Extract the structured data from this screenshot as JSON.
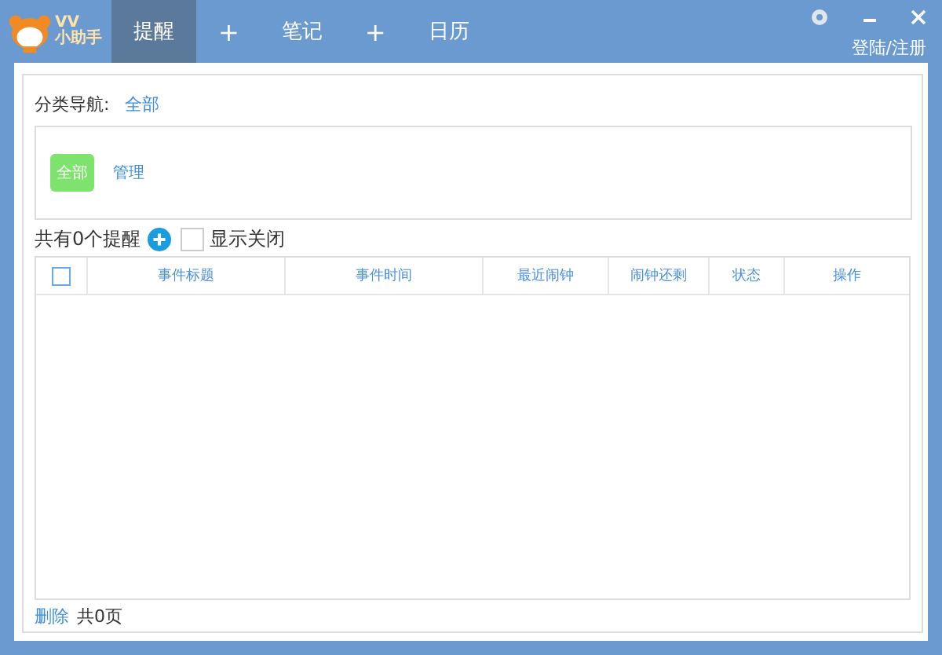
{
  "logo": {
    "line_1": "VV",
    "line_2": "小助手"
  },
  "tabs": [
    {
      "label": "提醒",
      "selected": true,
      "kind": "tab"
    },
    {
      "label": "+",
      "selected": false,
      "kind": "add"
    },
    {
      "label": "笔记",
      "selected": false,
      "kind": "tab"
    },
    {
      "label": "+",
      "selected": false,
      "kind": "add"
    },
    {
      "label": "日历",
      "selected": false,
      "kind": "tab"
    }
  ],
  "account": {
    "login": "登陆/注册"
  },
  "category_nav": {
    "label": "分类导航:",
    "current": "全部"
  },
  "categories": [
    {
      "label": "全部",
      "selected": true
    }
  ],
  "manage": "管理",
  "summary": {
    "count_text": "共有0个提醒",
    "show_closed": {
      "label": "显示关闭",
      "checked": false
    }
  },
  "table": {
    "select_all": false,
    "columns": [
      "事件标题",
      "事件时间",
      "最近闹钟",
      "闹钟还剩",
      "状态",
      "操作"
    ]
  },
  "footer": {
    "delete": "删除",
    "pages": "共0页"
  }
}
